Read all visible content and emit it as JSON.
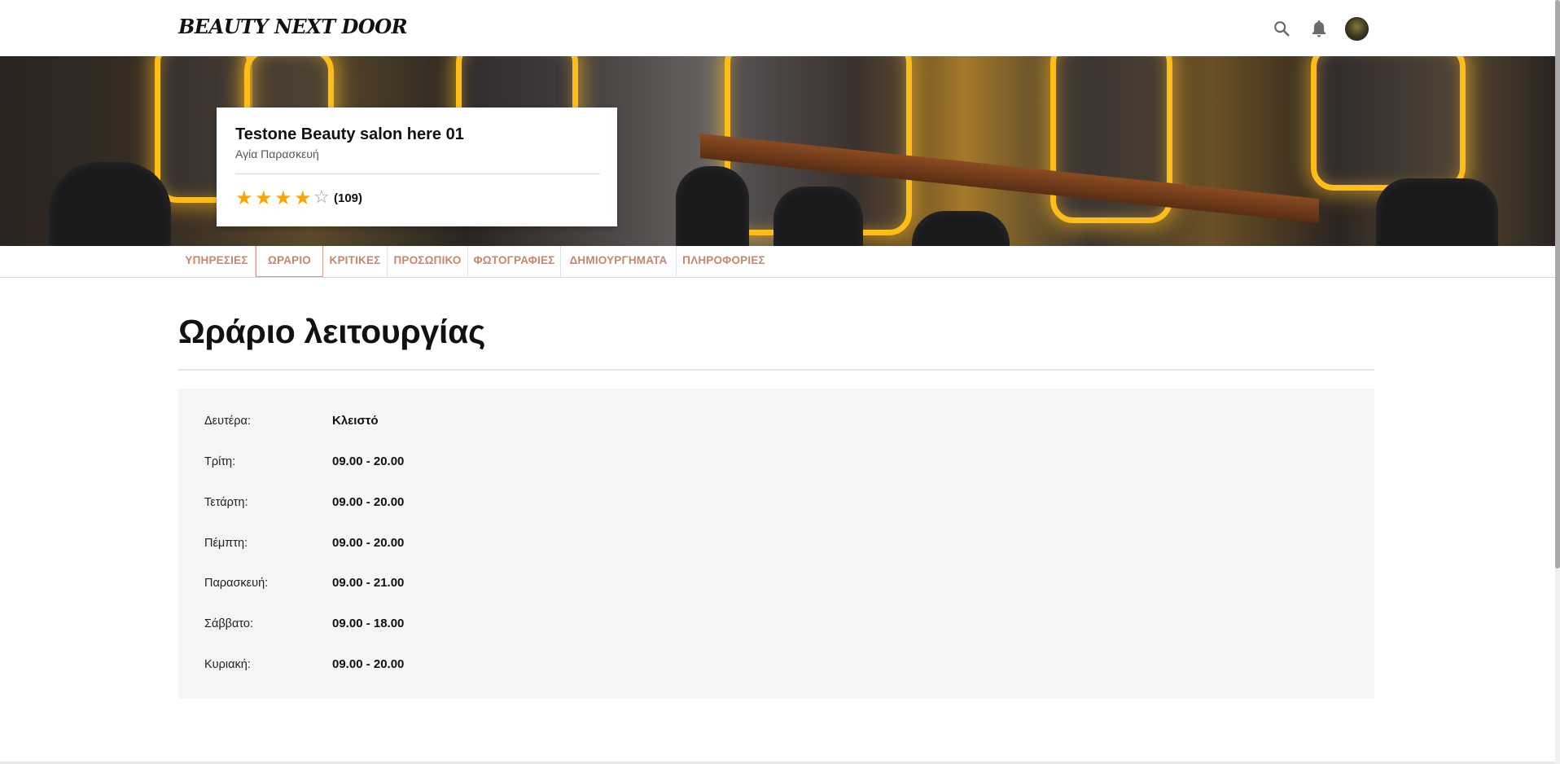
{
  "header": {
    "logo": "BEAUTY NEXT DOOR",
    "icons": [
      "search-icon",
      "bell-icon",
      "avatar"
    ]
  },
  "salon": {
    "name": "Testone Beauty salon here 01",
    "location": "Αγία Παρασκευή",
    "rating": 4,
    "rating_max": 5,
    "review_count": "(109)"
  },
  "tabs": [
    {
      "label": "ΥΠΗΡΕΣΙΕΣ",
      "active": false
    },
    {
      "label": "ΩΡΑΡΙΟ",
      "active": true
    },
    {
      "label": "ΚΡΙΤΙΚΕΣ",
      "active": false
    },
    {
      "label": "ΠΡΟΣΩΠΙΚΟ",
      "active": false
    },
    {
      "label": "ΦΩΤΟΓΡΑΦΙΕΣ",
      "active": false
    },
    {
      "label": "ΔΗΜΙΟΥΡΓΗΜΑΤΑ",
      "active": false
    },
    {
      "label": "ΠΛΗΡΟΦΟΡΙΕΣ",
      "active": false
    }
  ],
  "main": {
    "title": "Ωράριο λειτουργίας",
    "hours": [
      {
        "day": "Δευτέρα:",
        "time": "Κλειστό"
      },
      {
        "day": "Τρίτη:",
        "time": "09.00 - 20.00"
      },
      {
        "day": "Τετάρτη:",
        "time": "09.00 - 20.00"
      },
      {
        "day": "Πέμπτη:",
        "time": "09.00 - 20.00"
      },
      {
        "day": "Παρασκευή:",
        "time": "09.00 - 21.00"
      },
      {
        "day": "Σάββατο:",
        "time": "09.00 - 18.00"
      },
      {
        "day": "Κυριακή:",
        "time": "09.00 - 20.00"
      }
    ]
  },
  "colors": {
    "tab_text": "#c4876b",
    "star": "#f5a800",
    "hours_bg": "#f4f5f7"
  }
}
